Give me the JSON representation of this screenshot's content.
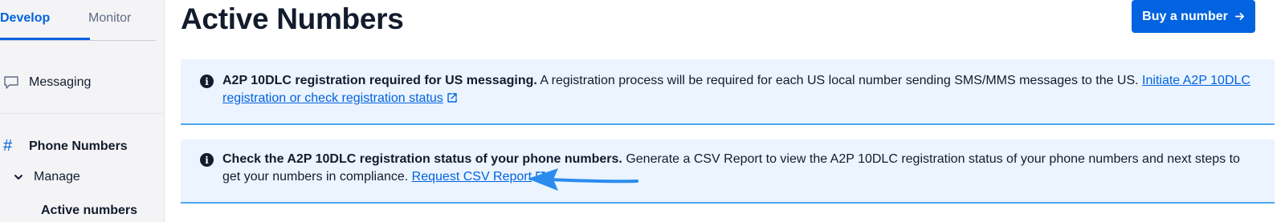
{
  "sidebar": {
    "tabs": [
      {
        "label": "Develop",
        "active": true
      },
      {
        "label": "Monitor",
        "active": false
      }
    ],
    "items": {
      "messaging": "Messaging",
      "phone_numbers": "Phone Numbers",
      "manage": "Manage",
      "active_numbers": "Active numbers"
    }
  },
  "header": {
    "title": "Active Numbers",
    "buy_button": "Buy a number",
    "buy_button_icon": "arrow-right-icon"
  },
  "callouts": [
    {
      "icon": "info-icon",
      "bold": "A2P 10DLC registration required for US messaging.",
      "text": " A registration process will be required for each US local number sending SMS/MMS messages to the US. ",
      "link": "Initiate A2P 10DLC registration or check registration status"
    },
    {
      "icon": "info-icon",
      "bold": "Check the A2P 10DLC registration status of your phone numbers.",
      "text": " Generate a CSV Report to view the A2P 10DLC registration status of your phone numbers and next steps to get your numbers in compliance. ",
      "link": "Request CSV Report"
    }
  ],
  "colors": {
    "accent": "#0263e0",
    "callout_bg": "#ebf4ff",
    "callout_border": "#4ea4f5",
    "annotation_arrow": "#2b8cee"
  }
}
